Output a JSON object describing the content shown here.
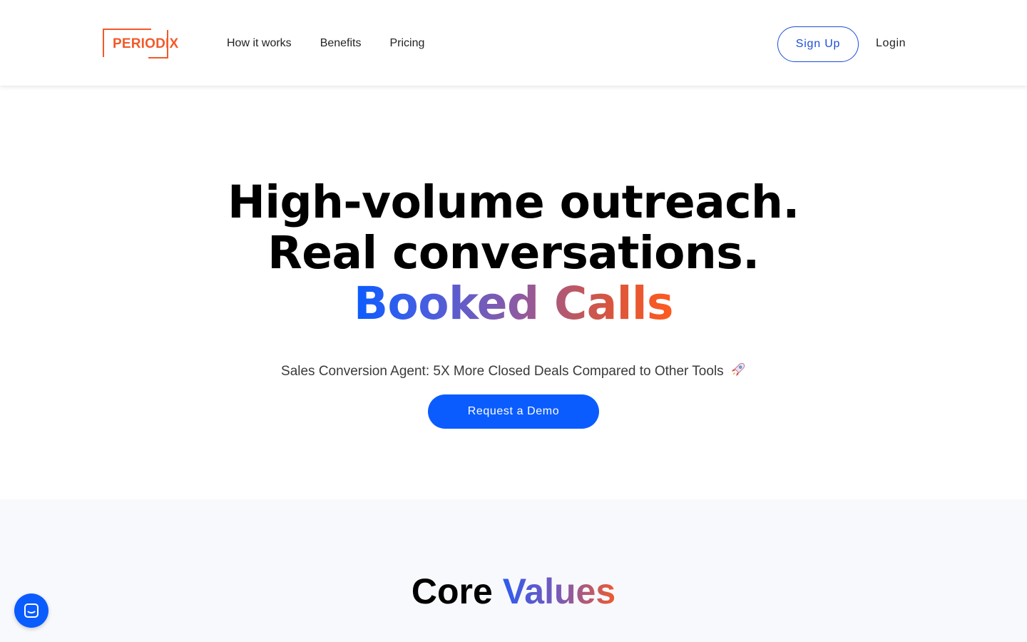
{
  "brand": {
    "logo_text": "PERIODIX",
    "accent_color": "#f25a2a",
    "primary_color": "#0b5cff"
  },
  "nav": {
    "links": [
      {
        "label": "How it works"
      },
      {
        "label": "Benefits"
      },
      {
        "label": "Pricing"
      }
    ],
    "signup_label": "Sign Up",
    "login_label": "Login"
  },
  "hero": {
    "line1": "High-volume outreach.",
    "line2": "Real conversations.",
    "line3": "Booked Calls",
    "subtitle": "Sales Conversion Agent: 5X More Closed Deals Compared to Other Tools",
    "subtitle_icon": "rocket-icon",
    "cta_label": "Request a Demo"
  },
  "core_values": {
    "title_plain": "Core",
    "title_gradient": "Values"
  },
  "chat": {
    "icon": "chat-icon"
  }
}
